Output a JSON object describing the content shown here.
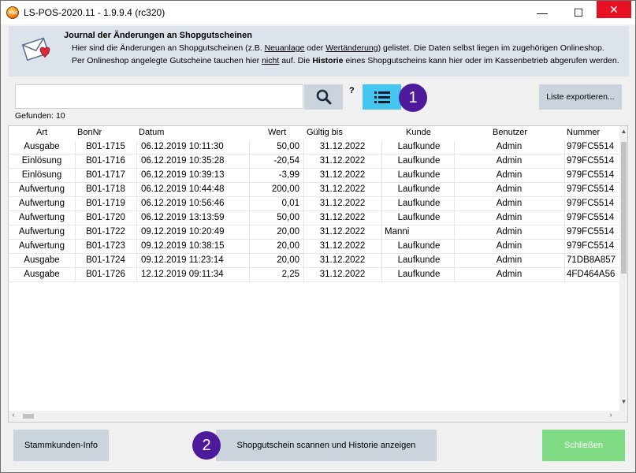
{
  "window": {
    "title": "LS-POS-2020.11 - 1.9.9.4 (rc320)",
    "app_icon_text": "POS",
    "minimize": "—",
    "maximize": "☐",
    "close": "✕"
  },
  "header": {
    "title": "Journal der Änderungen an Shopgutscheinen",
    "line1_a": "Hier sind die Änderungen an Shopgutscheinen (z.B. ",
    "line1_b": "Neuanlage",
    "line1_c": " oder ",
    "line1_d": "Wertänderung",
    "line1_e": ") gelistet. Die Daten selbst liegen im zugehörigen Onlineshop.",
    "line2_a": "Per Onlineshop angelegte Gutscheine tauchen hier ",
    "line2_b": "nicht",
    "line2_c": " auf. Die ",
    "line2_d": "Historie",
    "line2_e": " eines Shopgutscheins kann hier oder im Kassenbetrieb abgerufen werden."
  },
  "toolbar": {
    "search_value": "",
    "help": "?",
    "badge1": "1",
    "export_label": "Liste exportieren..."
  },
  "found_label": "Gefunden: 10",
  "table": {
    "columns": [
      "Art",
      "BonNr",
      "Datum",
      "Wert",
      "Gültig bis",
      "Kunde",
      "Benutzer",
      "Nummer"
    ],
    "rows": [
      [
        "Ausgabe",
        "B01-1715",
        "06.12.2019 10:11:30",
        "50,00",
        "31.12.2022",
        "Laufkunde",
        "Admin",
        "979FC5514"
      ],
      [
        "Einlösung",
        "B01-1716",
        "06.12.2019 10:35:28",
        "-20,54",
        "31.12.2022",
        "Laufkunde",
        "Admin",
        "979FC5514"
      ],
      [
        "Einlösung",
        "B01-1717",
        "06.12.2019 10:39:13",
        "-3,99",
        "31.12.2022",
        "Laufkunde",
        "Admin",
        "979FC5514"
      ],
      [
        "Aufwertung",
        "B01-1718",
        "06.12.2019 10:44:48",
        "200,00",
        "31.12.2022",
        "Laufkunde",
        "Admin",
        "979FC5514"
      ],
      [
        "Aufwertung",
        "B01-1719",
        "06.12.2019 10:56:46",
        "0,01",
        "31.12.2022",
        "Laufkunde",
        "Admin",
        "979FC5514"
      ],
      [
        "Aufwertung",
        "B01-1720",
        "06.12.2019 13:13:59",
        "50,00",
        "31.12.2022",
        "Laufkunde",
        "Admin",
        "979FC5514"
      ],
      [
        "Aufwertung",
        "B01-1722",
        "09.12.2019 10:20:49",
        "20,00",
        "31.12.2022",
        "Manni",
        "Admin",
        "979FC5514"
      ],
      [
        "Aufwertung",
        "B01-1723",
        "09.12.2019 10:38:15",
        "20,00",
        "31.12.2022",
        "Laufkunde",
        "Admin",
        "979FC5514"
      ],
      [
        "Ausgabe",
        "B01-1724",
        "09.12.2019 11:23:14",
        "20,00",
        "31.12.2022",
        "Laufkunde",
        "Admin",
        "71DB8A857"
      ],
      [
        "Ausgabe",
        "B01-1726",
        "12.12.2019 09:11:34",
        "2,25",
        "31.12.2022",
        "Laufkunde",
        "Admin",
        "4FD464A56"
      ]
    ]
  },
  "footer": {
    "stammkunden_label": "Stammkunden-Info",
    "badge2": "2",
    "scan_label": "Shopgutschein scannen und Historie anzeigen",
    "close_label": "Schließen"
  },
  "colors": {
    "header_bg": "#dde3ea",
    "button_bg": "#cbd3dc",
    "list_button": "#45c6f0",
    "badge": "#4d1a9c",
    "close_button": "#7fdc84",
    "titlebar_close": "#e81123"
  },
  "icons": [
    "app-logo-icon",
    "envelope-heart-icon",
    "search-icon",
    "list-icon",
    "help-icon"
  ]
}
